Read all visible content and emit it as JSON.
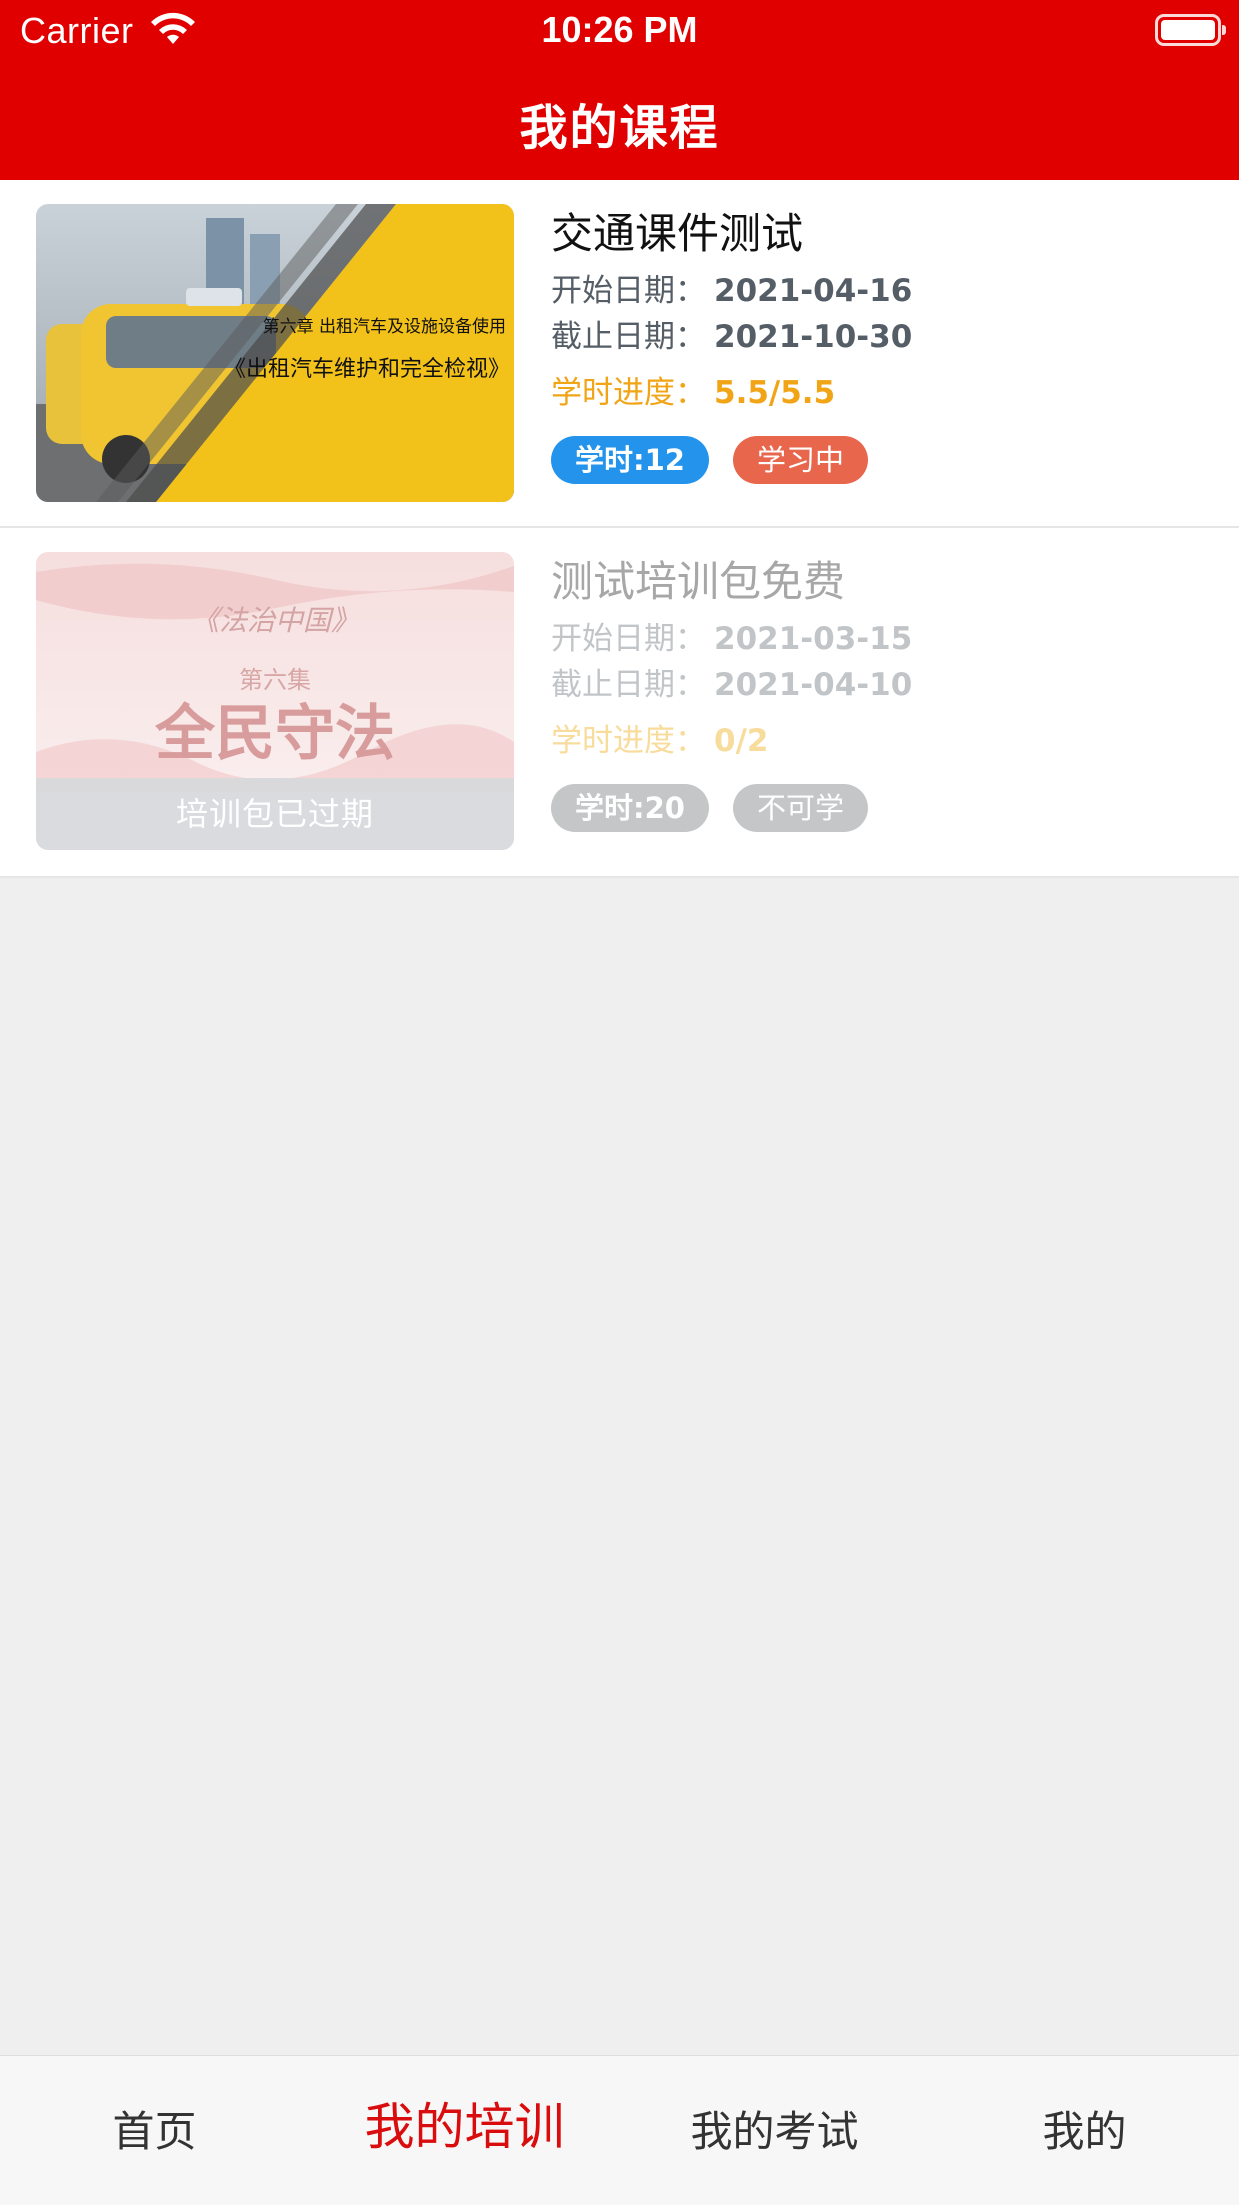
{
  "status_bar": {
    "carrier": "Carrier",
    "time": "10:26 PM"
  },
  "header": {
    "title": "我的课程",
    "color": "#e10000"
  },
  "courses": [
    {
      "thumbnail": {
        "chapter_text": "第六章  出租汽车及设施设备使用",
        "title_text": "《出租汽车维护和完全检视》"
      },
      "title": "交通课件测试",
      "start_label": "开始日期：",
      "start_date": "2021-04-16",
      "end_label": "截止日期：",
      "end_date": "2021-10-30",
      "progress_label": "学时进度：",
      "progress_value": "5.5/5.5",
      "hours_tag": "学时:12",
      "status_tag": "学习中"
    },
    {
      "thumbnail": {
        "series_text": "《法治中国》",
        "episode_text": "第六集",
        "headline_text": "全民守法",
        "overlay_text": "培训包已过期"
      },
      "title": "测试培训包免费",
      "start_label": "开始日期：",
      "start_date": "2021-03-15",
      "end_label": "截止日期：",
      "end_date": "2021-04-10",
      "progress_label": "学时进度：",
      "progress_value": "0/2",
      "hours_tag": "学时:20",
      "status_tag": "不可学"
    }
  ],
  "tab_bar": {
    "tabs": [
      {
        "label": "首页"
      },
      {
        "label": "我的培训"
      },
      {
        "label": "我的考试"
      },
      {
        "label": "我的"
      }
    ],
    "active_color": "#d90d0d"
  }
}
